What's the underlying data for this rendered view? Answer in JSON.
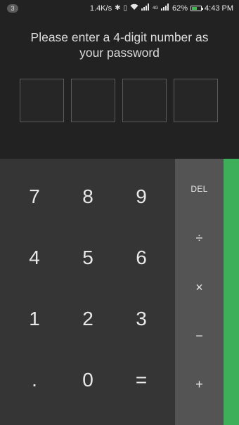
{
  "status_bar": {
    "notification_count": "3",
    "network_speed": "1.4K/s",
    "battery_percent": "62%",
    "time": "4:43 PM",
    "signal_label_1": "4G",
    "battery_level": 0.62,
    "battery_color": "#3dbb4d"
  },
  "prompt": {
    "line1": "Please enter a 4-digit number as",
    "line2": "your password"
  },
  "pin": {
    "box_count": 4,
    "entered": ""
  },
  "keypad": {
    "rows": [
      [
        "7",
        "8",
        "9"
      ],
      [
        "4",
        "5",
        "6"
      ],
      [
        "1",
        "2",
        "3"
      ],
      [
        ".",
        "0",
        "="
      ]
    ]
  },
  "operators": {
    "del": "DEL",
    "divide": "÷",
    "multiply": "×",
    "minus": "−",
    "plus": "+"
  },
  "colors": {
    "background": "#222222",
    "keypad": "#353535",
    "operators": "#545454",
    "accent_green": "#3daf5b"
  }
}
